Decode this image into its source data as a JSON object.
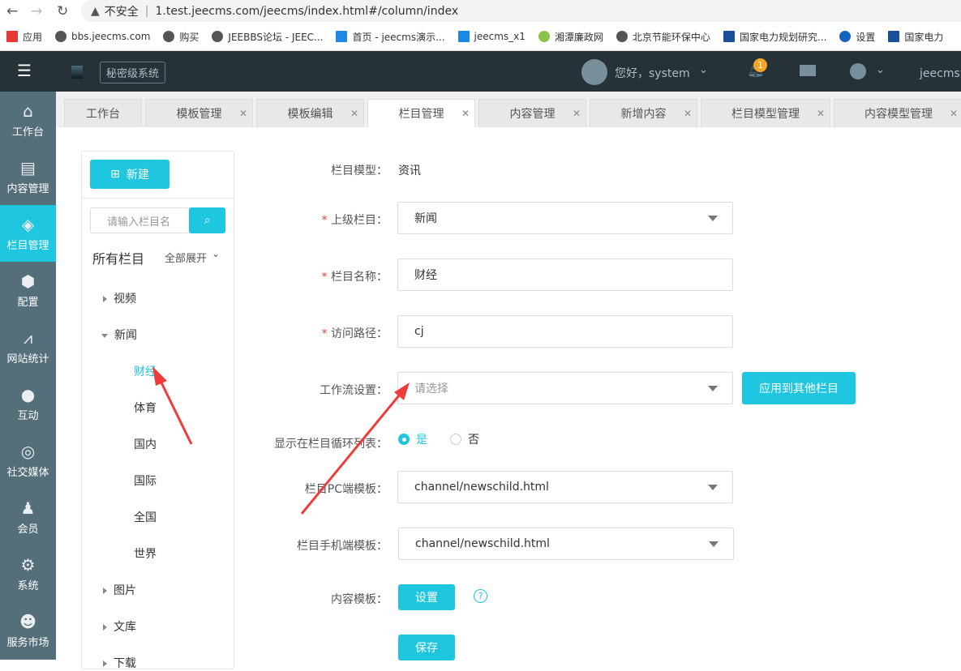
{
  "browser": {
    "insecure": "不安全",
    "url": "1.test.jeecms.com/jeecms/index.html#/column/index",
    "bookmarks": [
      "应用",
      "bbs.jeecms.com",
      "购买",
      "JEEBBS论坛 - JEEC...",
      "首页 - jeecms演示...",
      "jeecms_x1",
      "湘潭廉政网",
      "北京节能环保中心",
      "国家电力规划研究...",
      "设置",
      "国家电力"
    ]
  },
  "header": {
    "system_badge": "秘密级系统",
    "greeting": "您好，system",
    "notif_count": "1",
    "site": "jeecms演"
  },
  "sidebar": {
    "items": [
      {
        "label": "工作台",
        "icon": "home-icon"
      },
      {
        "label": "内容管理",
        "icon": "document-icon"
      },
      {
        "label": "栏目管理",
        "icon": "layers-icon"
      },
      {
        "label": "配置",
        "icon": "box-icon"
      },
      {
        "label": "网站统计",
        "icon": "chart-icon"
      },
      {
        "label": "互动",
        "icon": "chat-icon"
      },
      {
        "label": "社交媒体",
        "icon": "social-icon"
      },
      {
        "label": "会员",
        "icon": "user-icon"
      },
      {
        "label": "系统",
        "icon": "gear-icon"
      },
      {
        "label": "服务市场",
        "icon": "service-icon"
      }
    ],
    "active": 2
  },
  "tabs": [
    "工作台",
    "模板管理",
    "模板编辑",
    "栏目管理",
    "内容管理",
    "新增内容",
    "栏目模型管理",
    "内容模型管理"
  ],
  "tree": {
    "new_label": "新建",
    "search_placeholder": "请输入栏目名",
    "title": "所有栏目",
    "expand_all": "全部展开",
    "nodes": {
      "video": "视频",
      "news": "新闻",
      "finance": "财经",
      "sports": "体育",
      "domestic": "国内",
      "intl": "国际",
      "national": "全国",
      "world": "世界",
      "pictures": "图片",
      "library": "文库",
      "download": "下载"
    }
  },
  "form": {
    "model_label": "栏目模型：",
    "model_value": "资讯",
    "parent_label": "上级栏目：",
    "parent_value": "新闻",
    "name_label": "栏目名称：",
    "name_value": "财经",
    "path_label": "访问路径：",
    "path_value": "cj",
    "workflow_label": "工作流设置：",
    "workflow_placeholder": "请选择",
    "apply_label": "应用到其他栏目",
    "show_label": "显示在栏目循环列表：",
    "yes": "是",
    "no": "否",
    "show_value": "是",
    "pc_tpl_label": "栏目PC端模板：",
    "pc_tpl_value": "channel/newschild.html",
    "mobile_tpl_label": "栏目手机端模板：",
    "mobile_tpl_value": "channel/newschild.html",
    "content_tpl_label": "内容模板：",
    "set_label": "设置",
    "save_label": "保存",
    "required_mark": "*"
  }
}
